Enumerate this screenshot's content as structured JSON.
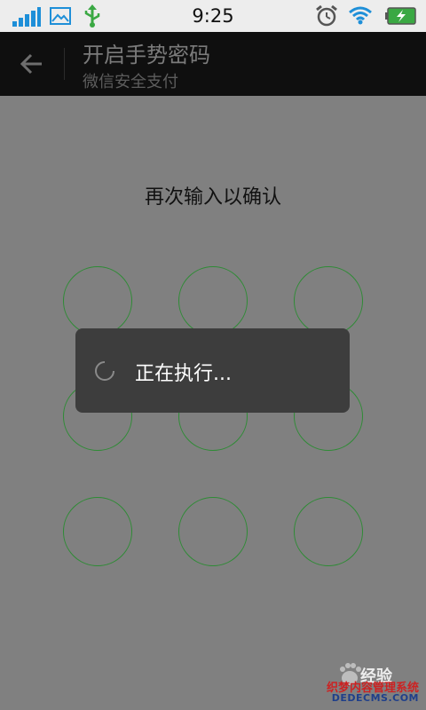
{
  "status_bar": {
    "time": "9:25",
    "left_icons": [
      "signal-icon",
      "image-icon",
      "usb-icon"
    ],
    "right_icons": [
      "alarm-icon",
      "wifi-icon",
      "battery-charging-icon"
    ]
  },
  "action_bar": {
    "title": "开启手势密码",
    "subtitle": "微信安全支付",
    "back_icon": "back-arrow-icon"
  },
  "pattern": {
    "prompt": "再次输入以确认",
    "rows": 3,
    "cols": 3,
    "dot_color": "#2e8b35"
  },
  "progress_dialog": {
    "message": "正在执行...",
    "spinner_icon": "loading-spinner-icon"
  },
  "watermark": {
    "baidu_text": "经验",
    "dede_line1": "织梦内容管理系统",
    "dede_line2": "DEDECMS.COM"
  },
  "colors": {
    "background": "#808080",
    "status_bar": "#ededed",
    "action_bar": "#0f0f0f",
    "dialog": "#3d3d3d"
  }
}
